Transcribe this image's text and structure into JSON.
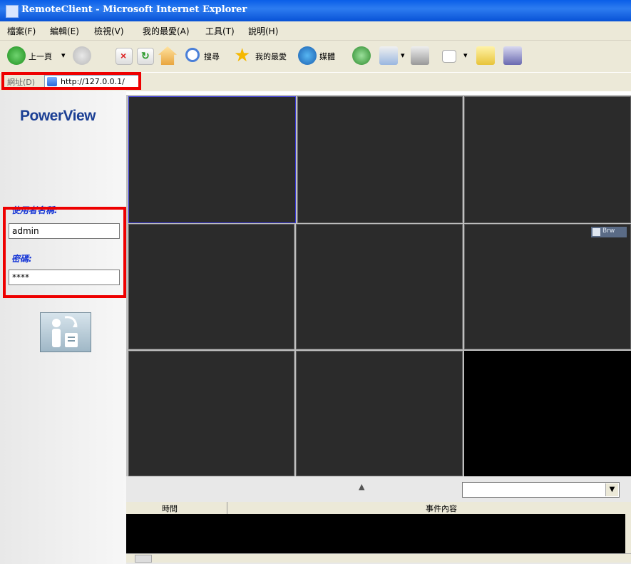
{
  "window": {
    "title": "RemoteClient - Microsoft Internet Explorer"
  },
  "menu": {
    "items": [
      "檔案(F)",
      "編輯(E)",
      "檢視(V)",
      "我的最愛(A)",
      "工具(T)",
      "說明(H)"
    ]
  },
  "toolbar": {
    "back_label": "上一頁",
    "search_label": "搜尋",
    "favorites_label": "我的最愛",
    "media_label": "媒體"
  },
  "address": {
    "label": "網址(D)",
    "url": "http://127.0.0.1/"
  },
  "app": {
    "logo": "PowerView"
  },
  "login": {
    "username_label": "使用者名稱:",
    "username_value": "admin",
    "password_label": "密碼:",
    "password_value": "****"
  },
  "grid": {
    "overlay_label": "Brw"
  },
  "events": {
    "columns": [
      "時間",
      "事件內容"
    ]
  },
  "colors": {
    "accent_blue": "#1535d6",
    "logo_blue": "#1b3f94",
    "highlight_red": "#ee0000",
    "selected_cell_border": "#3a3ad8"
  }
}
